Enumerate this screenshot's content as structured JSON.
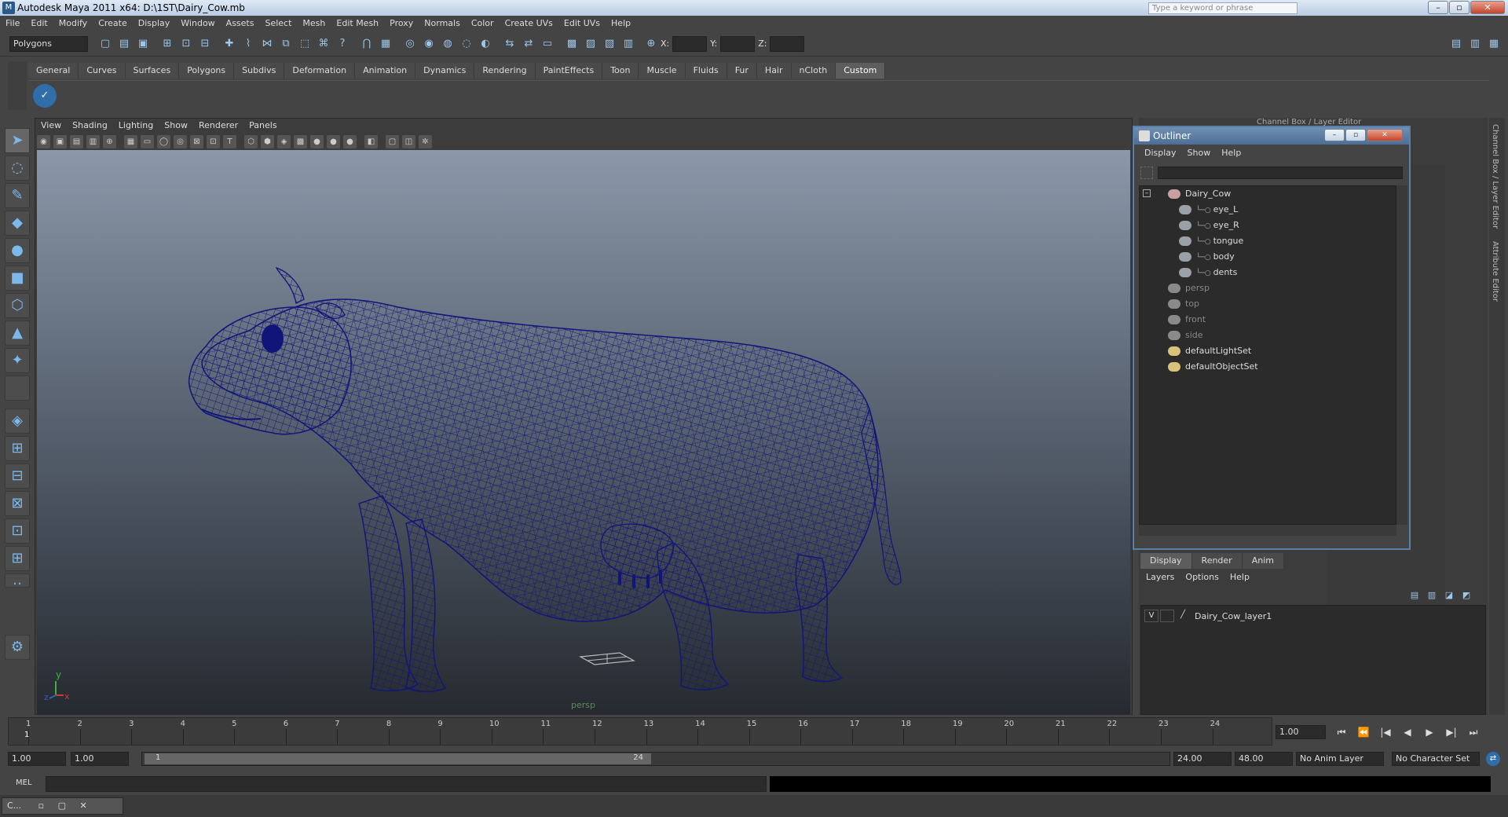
{
  "titlebar": {
    "title": "Autodesk Maya 2011 x64: D:\\1ST\\Dairy_Cow.mb",
    "search_placeholder": "Type a keyword or phrase",
    "minimize": "–",
    "maximize": "▫",
    "close": "✕"
  },
  "menubar": {
    "items": [
      "File",
      "Edit",
      "Modify",
      "Create",
      "Display",
      "Window",
      "Assets",
      "Select",
      "Mesh",
      "Edit Mesh",
      "Proxy",
      "Normals",
      "Color",
      "Create UVs",
      "Edit UVs",
      "Help"
    ]
  },
  "statusline": {
    "menuset": "Polygons",
    "x_label": "X:",
    "y_label": "Y:",
    "z_label": "Z:"
  },
  "shelf": {
    "tabs": [
      "General",
      "Curves",
      "Surfaces",
      "Polygons",
      "Subdivs",
      "Deformation",
      "Animation",
      "Dynamics",
      "Rendering",
      "PaintEffects",
      "Toon",
      "Muscle",
      "Fluids",
      "Fur",
      "Hair",
      "nCloth",
      "Custom"
    ],
    "active_tab": "Custom"
  },
  "viewport": {
    "menu": [
      "View",
      "Shading",
      "Lighting",
      "Show",
      "Renderer",
      "Panels"
    ],
    "camera_label": "persp",
    "axis_y": "y",
    "axis_x": "x",
    "axis_z": "z",
    "wireframe_color": "#11157a"
  },
  "outliner": {
    "title": "Outliner",
    "menu": [
      "Display",
      "Show",
      "Help"
    ],
    "items": [
      {
        "label": "Dairy_Cow",
        "type": "group",
        "indent": 0
      },
      {
        "label": "eye_L",
        "type": "mesh",
        "indent": 1
      },
      {
        "label": "eye_R",
        "type": "mesh",
        "indent": 1
      },
      {
        "label": "tongue",
        "type": "mesh",
        "indent": 1
      },
      {
        "label": "body",
        "type": "mesh",
        "indent": 1
      },
      {
        "label": "dents",
        "type": "mesh",
        "indent": 1
      },
      {
        "label": "persp",
        "type": "camera",
        "indent": 0
      },
      {
        "label": "top",
        "type": "camera",
        "indent": 0
      },
      {
        "label": "front",
        "type": "camera",
        "indent": 0
      },
      {
        "label": "side",
        "type": "camera",
        "indent": 0
      },
      {
        "label": "defaultLightSet",
        "type": "set",
        "indent": 0
      },
      {
        "label": "defaultObjectSet",
        "type": "set",
        "indent": 0
      }
    ]
  },
  "channel_box": {
    "header": "Channel Box / Layer Editor"
  },
  "layer_editor": {
    "tabs": [
      "Display",
      "Render",
      "Anim"
    ],
    "active_tab": "Display",
    "menu": [
      "Layers",
      "Options",
      "Help"
    ],
    "layer": {
      "visible": "V",
      "name": "Dairy_Cow_layer1"
    }
  },
  "side_tabs": [
    "Channel Box / Layer Editor",
    "Attribute Editor"
  ],
  "timeline": {
    "ticks": [
      "1",
      "2",
      "3",
      "4",
      "5",
      "6",
      "7",
      "8",
      "9",
      "10",
      "11",
      "12",
      "13",
      "14",
      "15",
      "16",
      "17",
      "18",
      "19",
      "20",
      "21",
      "22",
      "23",
      "24"
    ],
    "current_frame_marker": "1",
    "current_time": "1.00"
  },
  "range": {
    "start": "1.00",
    "playback_start": "1.00",
    "slider_start": "1",
    "slider_end": "24",
    "playback_end": "24.00",
    "end": "48.00",
    "anim_layer": "No Anim Layer",
    "character_set": "No Character Set"
  },
  "playback_buttons": [
    "⏮",
    "⏪",
    "|◀",
    "◀",
    "▶",
    "▶|",
    "⏭"
  ],
  "mel": {
    "label": "MEL"
  },
  "taskbar": {
    "label": "C..."
  }
}
